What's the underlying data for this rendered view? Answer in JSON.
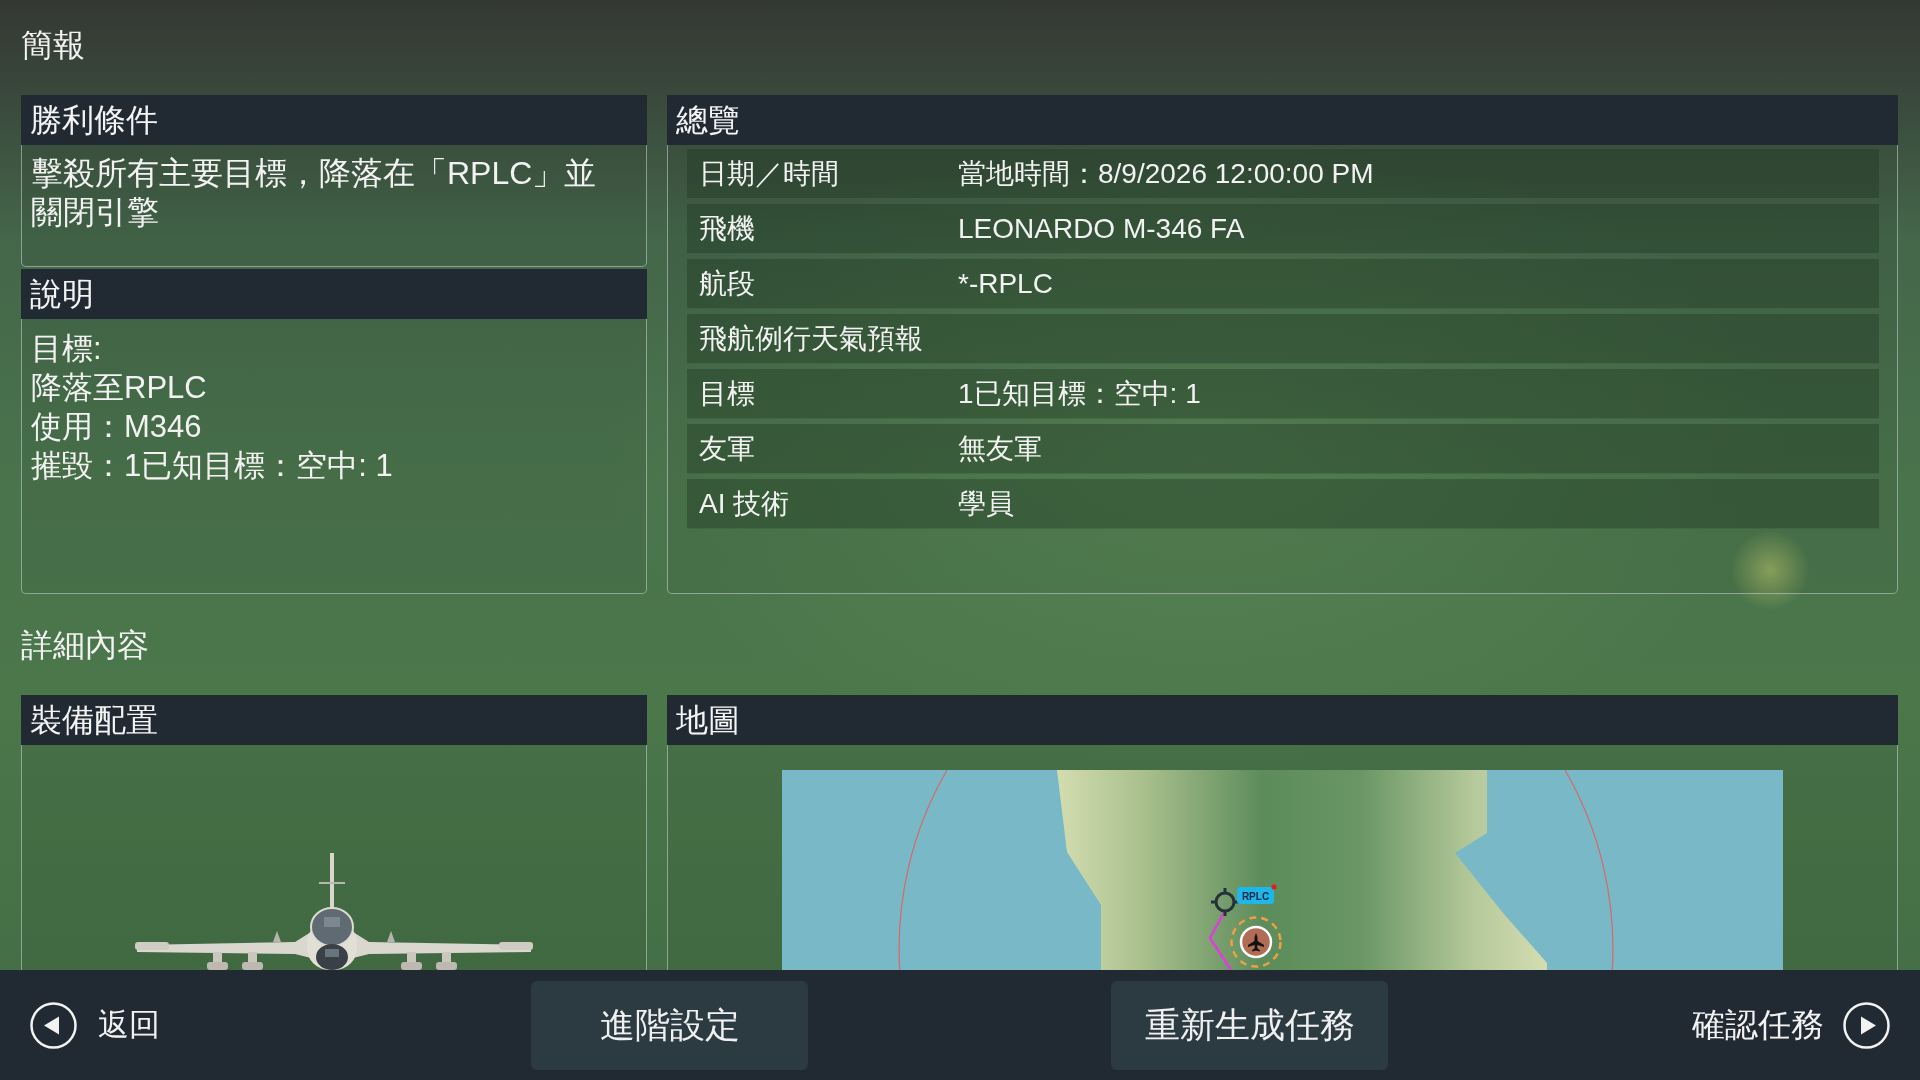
{
  "screen": {
    "title": "簡報"
  },
  "victory": {
    "title": "勝利條件",
    "text": "擊殺所有主要目標，降落在「RPLC」並關閉引擎"
  },
  "description": {
    "title": "說明",
    "lines": [
      "目標:",
      "降落至RPLC",
      "使用：M346",
      "摧毀：1已知目標：空中: 1"
    ]
  },
  "overview": {
    "title": "總覽",
    "rows": [
      {
        "label": "日期／時間",
        "value": "當地時間：8/9/2026 12:00:00 PM"
      },
      {
        "label": "飛機",
        "value": "LEONARDO M-346 FA"
      },
      {
        "label": "航段",
        "value": "*-RPLC"
      },
      {
        "label": "飛航例行天氣預報"
      },
      {
        "label": "目標",
        "value": "1已知目標：空中: 1"
      },
      {
        "label": "友軍",
        "value": "無友軍"
      },
      {
        "label": "AI 技術",
        "value": "學員"
      }
    ]
  },
  "details": {
    "title": "詳細內容"
  },
  "loadout": {
    "title": "裝備配置"
  },
  "map": {
    "title": "地圖",
    "markers": [
      {
        "kind": "airport",
        "label": "RPLC"
      },
      {
        "kind": "aircraft"
      }
    ]
  },
  "footer": {
    "buttons": [
      {
        "kind": "back",
        "label": "返回"
      },
      {
        "kind": "plain",
        "label": "進階設定"
      },
      {
        "kind": "plain",
        "label": "重新生成任務"
      },
      {
        "kind": "next",
        "label": "確認任務"
      }
    ]
  }
}
